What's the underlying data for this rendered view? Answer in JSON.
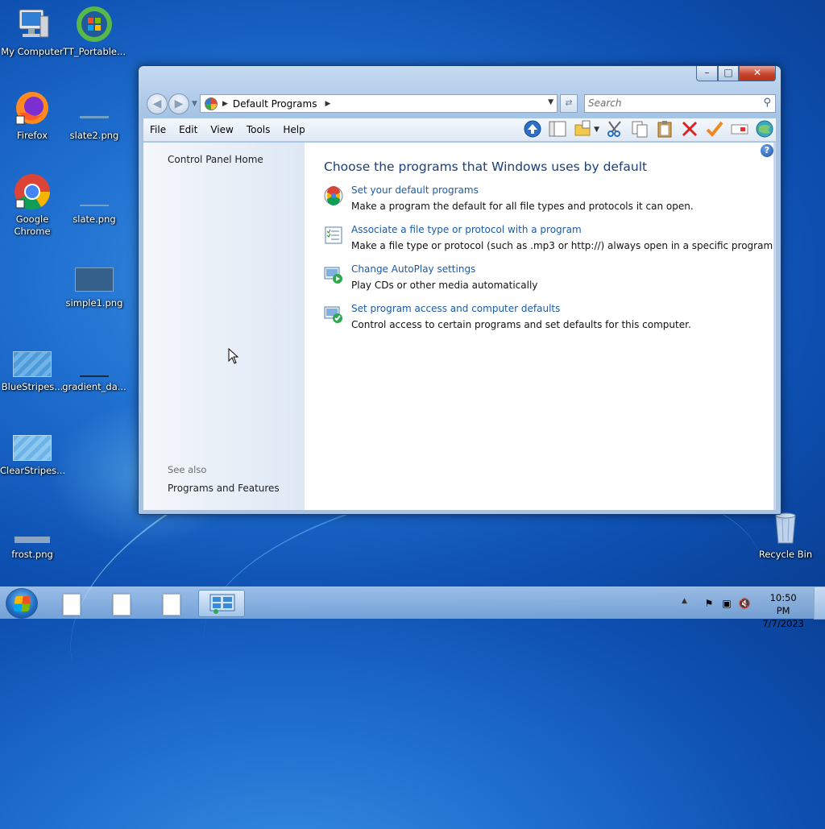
{
  "desktop": {
    "icons": [
      {
        "label": "My Computer"
      },
      {
        "label": "TT_Portable..."
      },
      {
        "label": "Firefox"
      },
      {
        "label": "slate2.png"
      },
      {
        "label": "Google Chrome"
      },
      {
        "label": "slate.png"
      },
      {
        "label": "simple1.png"
      },
      {
        "label": "BlueStripes..."
      },
      {
        "label": "gradient_da..."
      },
      {
        "label": "ClearStripes..."
      },
      {
        "label": "frost.png"
      },
      {
        "label": "Recycle Bin"
      }
    ]
  },
  "window": {
    "caption_buttons": {
      "minimize": "–",
      "maximize": "□",
      "close": "✕"
    },
    "address": {
      "path": "Default Programs"
    },
    "search": {
      "placeholder": "Search"
    },
    "menu": [
      "File",
      "Edit",
      "View",
      "Tools",
      "Help"
    ],
    "left_pane": {
      "home": "Control Panel Home",
      "see_also": "See also",
      "programs_and_features": "Programs and Features"
    },
    "heading": "Choose the programs that Windows uses by default",
    "tasks": [
      {
        "link": "Set your default programs",
        "desc": "Make a program the default for all file types and protocols it can open."
      },
      {
        "link": "Associate a file type or protocol with a program",
        "desc": "Make a file type or protocol (such as .mp3 or http://) always open in a specific program."
      },
      {
        "link": "Change AutoPlay settings",
        "desc": "Play CDs or other media automatically"
      },
      {
        "link": "Set program access and computer defaults",
        "desc": "Control access to certain programs and set defaults for this computer."
      }
    ]
  },
  "taskbar": {
    "time": "10:50 PM",
    "date": "7/7/2023"
  },
  "colors": {
    "link": "#1a5aa8",
    "heading": "#1c3f77"
  }
}
